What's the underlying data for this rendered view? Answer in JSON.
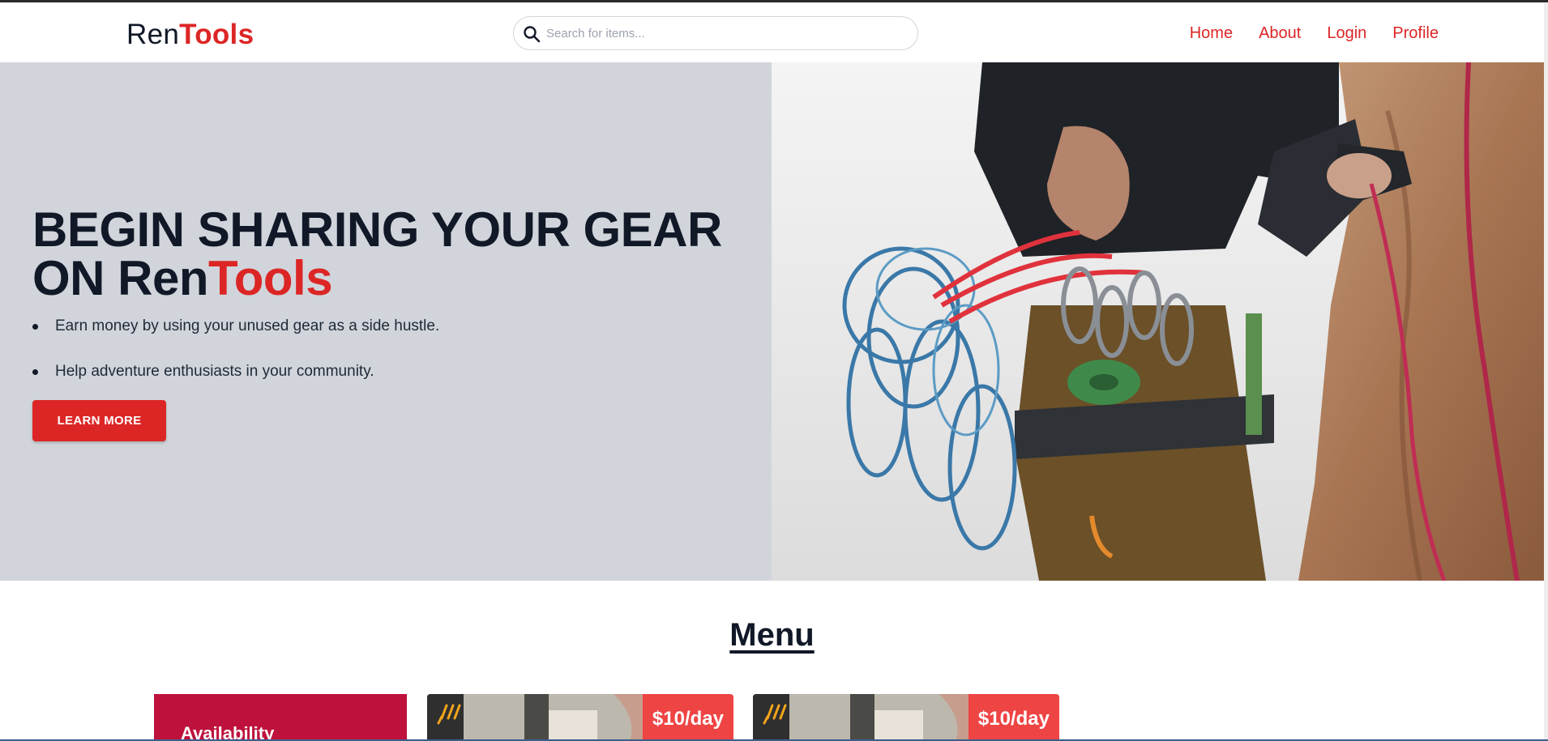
{
  "header": {
    "logo_part1": "Ren",
    "logo_part2": "Tools",
    "search_placeholder": "Search for items...",
    "nav": [
      "Home",
      "About",
      "Login",
      "Profile"
    ]
  },
  "hero": {
    "headline_line1": "BEGIN SHARING YOUR GEAR",
    "headline_line2_prefix": "ON ",
    "headline_brand1": "Ren",
    "headline_brand2": "Tools",
    "bullets": [
      "Earn money by using your unused gear as a side hustle.",
      "Help adventure enthusiasts in your community."
    ],
    "cta_label": "LEARN MORE",
    "image_icon": "climber-with-gear-photo"
  },
  "menu": {
    "title": "Menu",
    "availability_label": "Availability",
    "cards": [
      {
        "price": "$10/day",
        "image_icon": "item-photo"
      },
      {
        "price": "$10/day",
        "image_icon": "item-photo"
      }
    ]
  },
  "colors": {
    "accent": "#dc2626",
    "hero_bg": "#d1d5db",
    "availability_bg": "#be123c",
    "price_bg": "#ef4444",
    "text_dark": "#111827"
  }
}
